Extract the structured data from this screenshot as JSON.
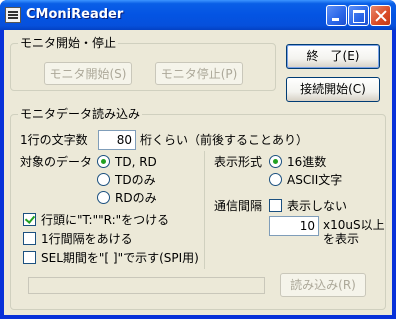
{
  "window": {
    "title": "CMoniReader"
  },
  "monitor_group": {
    "title": "モニタ開始・停止",
    "start_label": "モニタ開始(S)",
    "stop_label": "モニタ停止(P)"
  },
  "exit_label": "終　了(E)",
  "connect_label": "接続開始(C)",
  "read_group": {
    "title": "モニタデータ読み込み",
    "chars_per_line_label": "1行の文字数",
    "chars_per_line_value": "80",
    "chars_per_line_suffix": "桁くらい（前後することあり）",
    "target_label": "対象のデータ",
    "target_options": [
      "TD, RD",
      "TDのみ",
      "RDのみ"
    ],
    "display_label": "表示形式",
    "display_options": [
      "16進数",
      "ASCII文字"
    ],
    "prefix_label": "行頭に\"T:\"\"R:\"をつける",
    "blank_line_label": "1行間隔をあける",
    "sel_label": "SEL期間を\"[ ]\"で示す(SPI用)",
    "interval_label": "通信間隔",
    "interval_hide_label": "表示しない",
    "interval_value": "10",
    "interval_suffix_line1": "x10uS以上",
    "interval_suffix_line2": "を表示",
    "read_button_label": "読み込み(R)"
  }
}
